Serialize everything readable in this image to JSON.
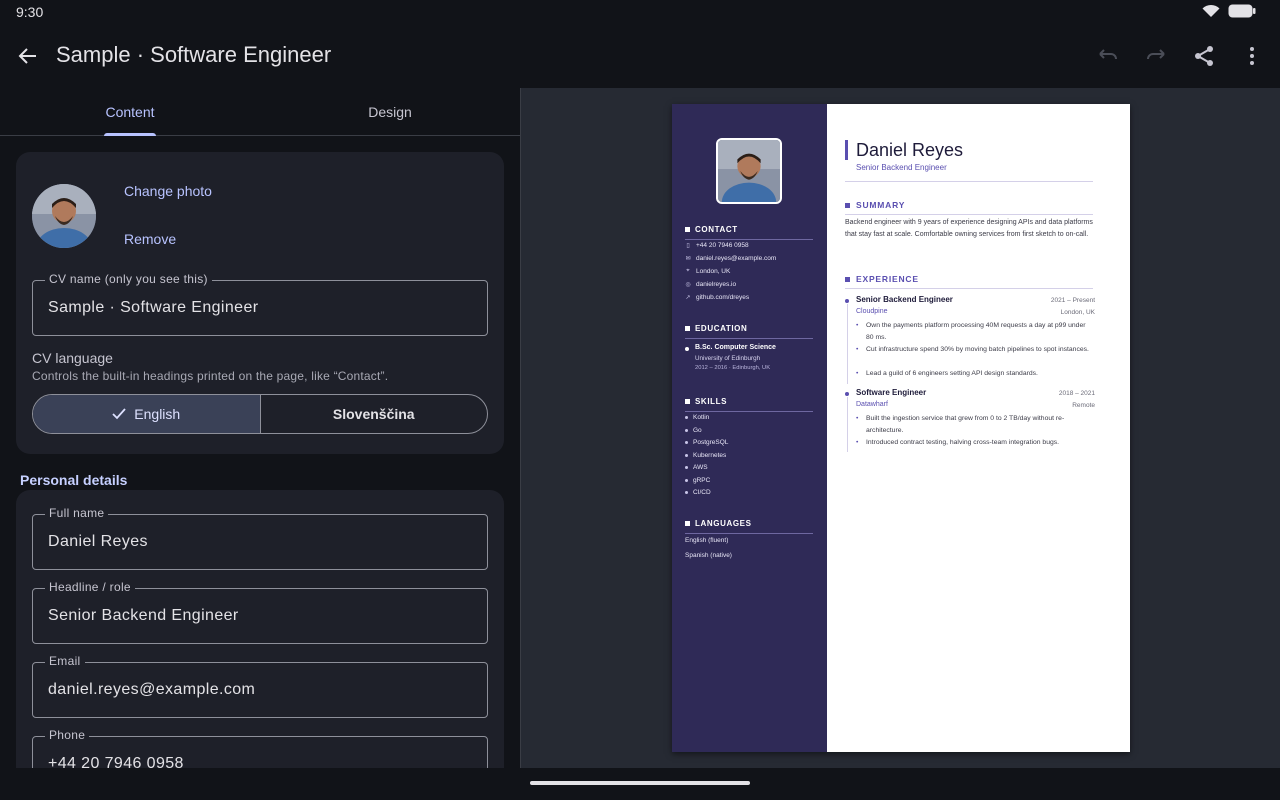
{
  "status": {
    "time": "9:30"
  },
  "appbar": {
    "title": "Sample · Software Engineer"
  },
  "tabs": [
    {
      "label": "Content"
    },
    {
      "label": "Design"
    }
  ],
  "photo": {
    "change": "Change photo",
    "remove": "Remove"
  },
  "cv_name": {
    "label": "CV name (only you see this)",
    "value": "Sample · Software Engineer"
  },
  "cv_language": {
    "title": "CV language",
    "help": "Controls the built-in headings printed on the page, like “Contact”.",
    "options": [
      {
        "label": "English",
        "selected": true
      },
      {
        "label": "Slovenščina",
        "selected": false
      }
    ]
  },
  "personal": {
    "heading": "Personal details",
    "fields": [
      {
        "label": "Full name",
        "value": "Daniel Reyes"
      },
      {
        "label": "Headline / role",
        "value": "Senior Backend Engineer"
      },
      {
        "label": "Email",
        "value": "daniel.reyes@example.com"
      },
      {
        "label": "Phone",
        "value": "+44 20 7946 0958"
      }
    ]
  },
  "cv": {
    "name": "Daniel Reyes",
    "role": "Senior Backend Engineer",
    "accent": "#5a4fb0",
    "sidebar_color": "#2f2a57",
    "contact": {
      "heading": "CONTACT",
      "items": [
        {
          "icon": "phone-icon",
          "text": "+44 20 7946 0958"
        },
        {
          "icon": "mail-icon",
          "text": "daniel.reyes@example.com"
        },
        {
          "icon": "location-icon",
          "text": "London, UK"
        },
        {
          "icon": "globe-icon",
          "text": "danielreyes.io"
        },
        {
          "icon": "link-icon",
          "text": "github.com/dreyes"
        }
      ]
    },
    "education": {
      "heading": "EDUCATION",
      "degree": "B.Sc. Computer Science",
      "school": "University of Edinburgh",
      "dates": "2012 – 2016 · Edinburgh, UK"
    },
    "skills": {
      "heading": "SKILLS",
      "items": [
        "Kotlin",
        "Go",
        "PostgreSQL",
        "Kubernetes",
        "AWS",
        "gRPC",
        "CI/CD"
      ]
    },
    "languages": {
      "heading": "LANGUAGES",
      "items": [
        "English (fluent)",
        "Spanish (native)"
      ]
    },
    "summary": {
      "heading": "SUMMARY",
      "text": "Backend engineer with 9 years of experience designing APIs and data platforms that stay fast at scale. Comfortable owning services from first sketch to on-call."
    },
    "experience": {
      "heading": "EXPERIENCE",
      "jobs": [
        {
          "title": "Senior Backend Engineer",
          "dates": "2021 – Present",
          "company": "Cloudpine",
          "location": "London, UK",
          "bullets": [
            "Own the payments platform processing 40M requests a day at p99 under 80 ms.",
            "Cut infrastructure spend 30% by moving batch pipelines to spot instances.",
            "Lead a guild of 6 engineers setting API design standards."
          ]
        },
        {
          "title": "Software Engineer",
          "dates": "2018 – 2021",
          "company": "Datawharf",
          "location": "Remote",
          "bullets": [
            "Built the ingestion service that grew from 0 to 2 TB/day without re-architecture.",
            "Introduced contract testing, halving cross-team integration bugs."
          ]
        }
      ]
    }
  }
}
